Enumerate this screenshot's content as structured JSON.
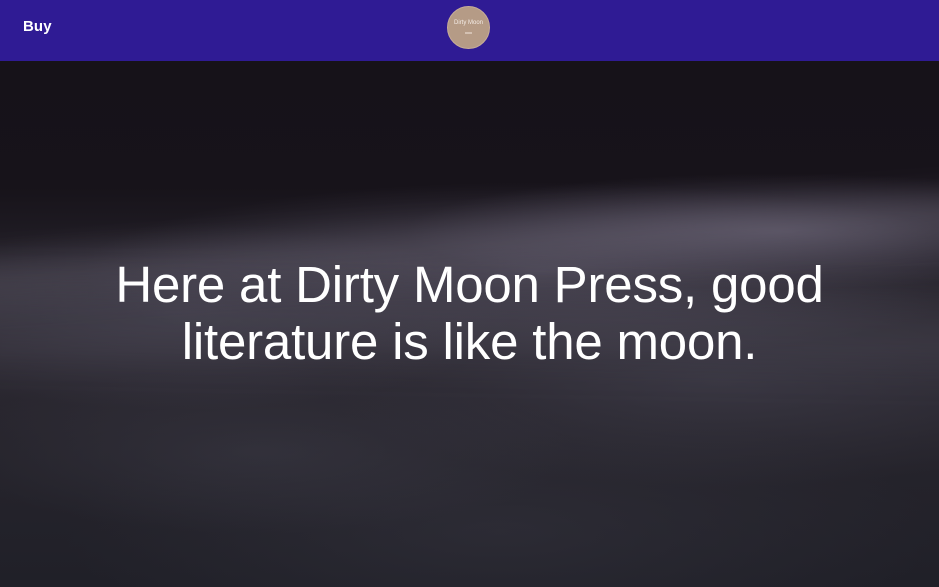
{
  "colors": {
    "navbar_background": "#2f1b94",
    "logo_background": "#b59b86",
    "hero_text": "#ffffff"
  },
  "nav": {
    "buy_label": "Buy",
    "logo": {
      "name": "Dirty Moon",
      "icon": "dirty-moon-logo"
    }
  },
  "hero": {
    "title": "Here at Dirty Moon Press, good literature is like the moon."
  }
}
